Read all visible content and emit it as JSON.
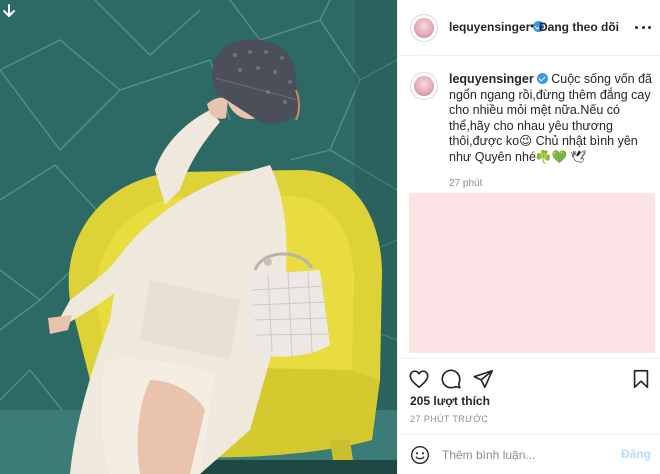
{
  "photo": {
    "download_icon": "download-arrow-icon"
  },
  "header": {
    "username": "lequyensinger",
    "separator": "•",
    "follow_label": "Đang theo dõi",
    "more_icon": "more-horizontal-icon"
  },
  "caption": {
    "username": "lequyensinger",
    "text": "Cuộc sống vốn đã ngổn ngang rồi,đừng thêm đắng cay cho nhiều mỏi mệt nữa.Nếu có thể,hãy cho nhau yêu thương thôi,được ko😉 Chủ nhật bình yên như Quyên nhé☘️💚 🕊",
    "time": "27 phút"
  },
  "actions": {
    "icons": [
      "heart-icon",
      "comment-icon",
      "share-icon",
      "bookmark-icon"
    ]
  },
  "likes": "205 lượt thích",
  "posted_ago": "27 PHÚT TRƯỚC",
  "comment": {
    "placeholder": "Thêm bình luận...",
    "post_label": "Đăng"
  },
  "colors": {
    "accent": "#3897f0",
    "post_disabled": "#b2dffc",
    "placeholder_block": "#fce4e6",
    "wall": "#2f6b66",
    "chair": "#e2d53a"
  }
}
